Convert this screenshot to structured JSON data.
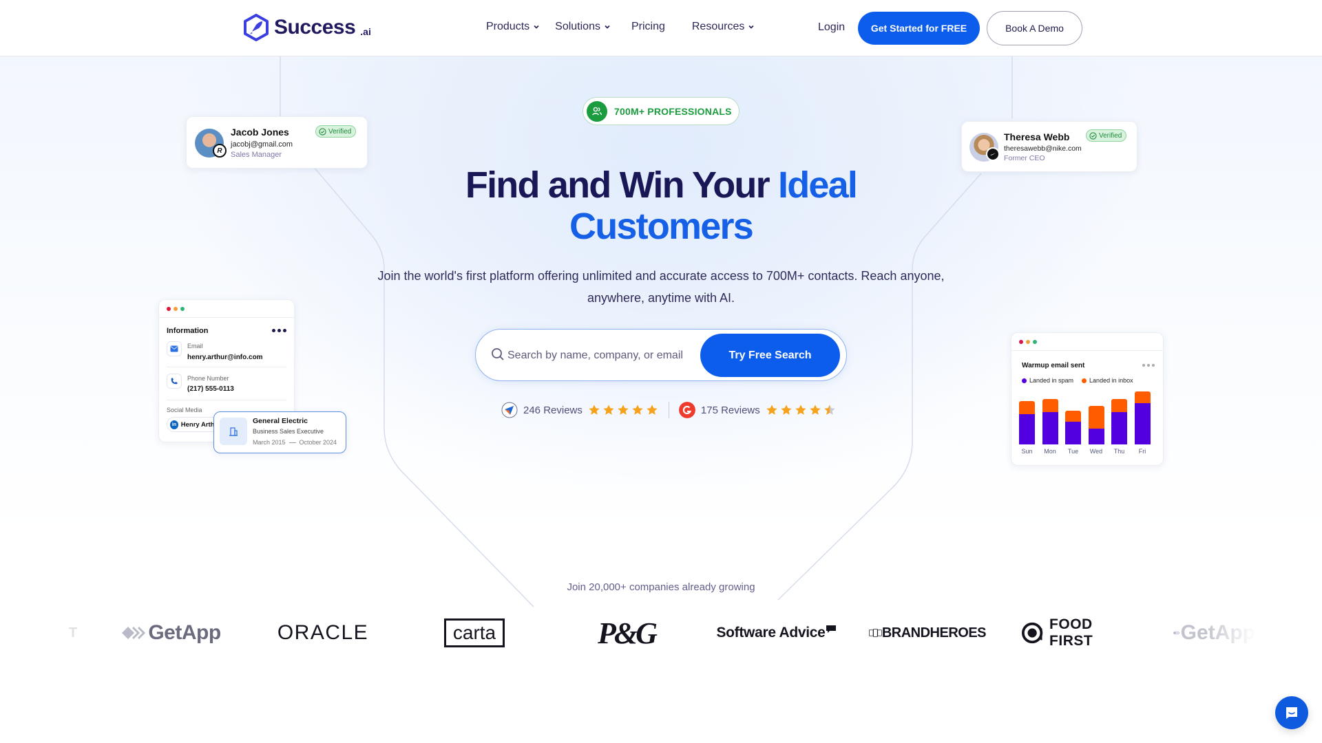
{
  "brand": {
    "name": "Success",
    "suffix": ".ai",
    "accent": "#0d5ded",
    "navy": "#1a1757"
  },
  "nav": {
    "items": [
      {
        "label": "Products",
        "has_dropdown": true
      },
      {
        "label": "Solutions",
        "has_dropdown": true
      },
      {
        "label": "Pricing",
        "has_dropdown": false
      },
      {
        "label": "Resources",
        "has_dropdown": true
      }
    ],
    "login": "Login",
    "cta": "Get Started for FREE",
    "demo": "Book A Demo"
  },
  "hero": {
    "badge": "700M+ PROFESSIONALS",
    "title_dark": "Find and Win Your ",
    "title_blue_1": "Ideal",
    "title_blue_2": "Customers",
    "subtitle": "Join the world's first platform offering unlimited and accurate access to 700M+ contacts. Reach anyone, anywhere, anytime with AI.",
    "search": {
      "placeholder": "Search by name, company, or email",
      "value": "",
      "button": "Try Free Search"
    },
    "reviews": [
      {
        "source": "capterra",
        "text": "246 Reviews",
        "rating": 5
      },
      {
        "source": "g2",
        "text": "175 Reviews",
        "rating": 4.5
      }
    ]
  },
  "profile_cards": [
    {
      "name": "Jacob Jones",
      "email": "jacobj@gmail.com",
      "role": "Sales Manager",
      "status": "Verified",
      "company_icon": "R"
    },
    {
      "name": "Theresa Webb",
      "email": "theresawebb@nike.com",
      "role": "Former CEO",
      "status": "Verified",
      "company_icon": "nike"
    }
  ],
  "info_card": {
    "title": "Information",
    "email_label": "Email",
    "email_value": "henry.arthur@info.com",
    "phone_label": "Phone Number",
    "phone_value": "(217) 555-0113",
    "social_label": "Social Media",
    "social_value": "Henry Arthur"
  },
  "experience_card": {
    "company": "General Electric",
    "title": "Business Sales Executive",
    "start": "March 2015",
    "end": "October 2024"
  },
  "warmup_card": {
    "title": "Warmup email sent",
    "legend": [
      {
        "label": "Landed in spam",
        "color": "#5200e0"
      },
      {
        "label": "Landed in inbox",
        "color": "#ff5c00"
      }
    ]
  },
  "chart_data": {
    "type": "bar",
    "stacked": true,
    "title": "Warmup email sent",
    "categories": [
      "Sun",
      "Mon",
      "Tue",
      "Wed",
      "Thu",
      "Fri"
    ],
    "series": [
      {
        "name": "Landed in spam",
        "values": [
          44,
          47,
          33,
          23,
          47,
          60
        ]
      },
      {
        "name": "Landed in inbox",
        "values": [
          19,
          19,
          16,
          33,
          19,
          17
        ]
      }
    ],
    "legend": "top-left",
    "grid": false
  },
  "companies": {
    "heading": "Join 20,000+ companies already growing",
    "logos": [
      "GetApp",
      "ORACLE",
      "carta",
      "P&G",
      "Software Advice",
      "BRANDHEROES",
      "FOOD FIRST",
      "GetApp"
    ]
  },
  "chat": {
    "icon": "chat-icon"
  }
}
